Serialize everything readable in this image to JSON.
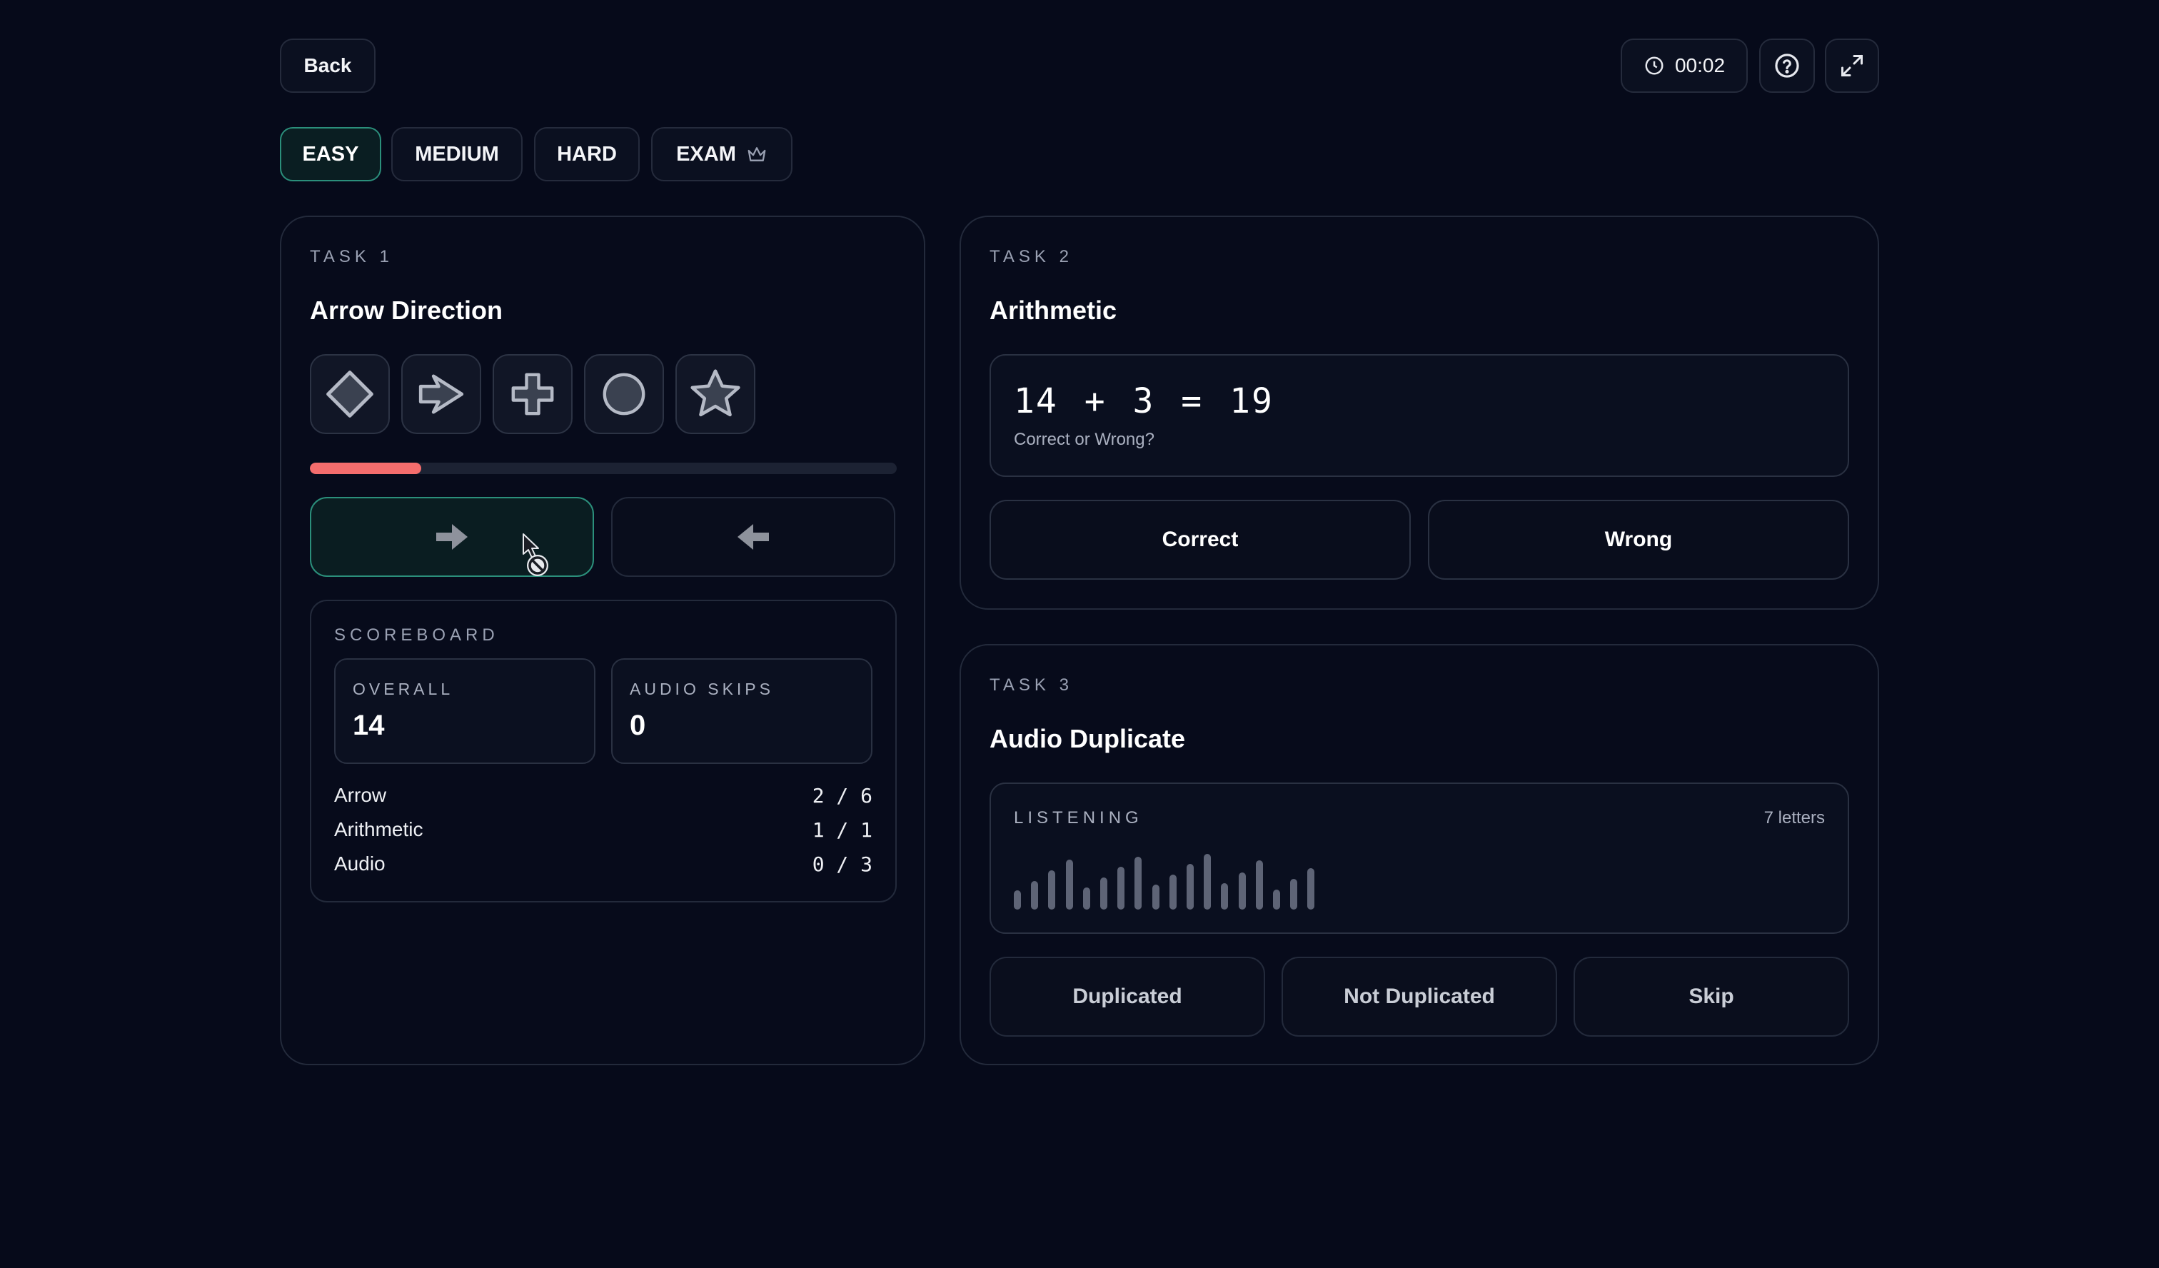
{
  "header": {
    "back_label": "Back",
    "timer": "00:02"
  },
  "difficulty_tabs": [
    {
      "label": "EASY",
      "active": true
    },
    {
      "label": "MEDIUM",
      "active": false
    },
    {
      "label": "HARD",
      "active": false
    },
    {
      "label": "EXAM",
      "active": false,
      "icon": "crown-icon"
    }
  ],
  "task1": {
    "eyebrow": "TASK 1",
    "title": "Arrow Direction",
    "shapes": [
      "diamond-icon",
      "arrow-outline-icon",
      "plus-icon",
      "circle-icon",
      "star-icon"
    ],
    "progress_fraction": 0.19,
    "buttons": [
      "arrow-right-icon",
      "arrow-left-icon"
    ]
  },
  "scoreboard": {
    "title": "SCOREBOARD",
    "overall_label": "OVERALL",
    "overall_value": "14",
    "audio_skips_label": "AUDIO SKIPS",
    "audio_skips_value": "0",
    "rows": [
      {
        "label": "Arrow",
        "value": "2 / 6"
      },
      {
        "label": "Arithmetic",
        "value": "1 / 1"
      },
      {
        "label": "Audio",
        "value": "0 / 3"
      }
    ]
  },
  "task2": {
    "eyebrow": "TASK 2",
    "title": "Arithmetic",
    "equation": "14 + 3 = 19",
    "prompt": "Correct or Wrong?",
    "correct_label": "Correct",
    "wrong_label": "Wrong"
  },
  "task3": {
    "eyebrow": "TASK 3",
    "title": "Audio Duplicate",
    "listening_label": "LISTENING",
    "letters_count": "7 letters",
    "waveform_levels": [
      0.27,
      0.46,
      0.67,
      0.89,
      0.33,
      0.53,
      0.74,
      0.94,
      0.38,
      0.58,
      0.8,
      1.0,
      0.42,
      0.63,
      0.87,
      0.29,
      0.5,
      0.72
    ],
    "duplicated_label": "Duplicated",
    "not_duplicated_label": "Not Duplicated",
    "skip_label": "Skip"
  },
  "colors": {
    "background": "#060a1a",
    "accent_teal": "#2b8f7b",
    "progress_red": "#f46d6d"
  }
}
